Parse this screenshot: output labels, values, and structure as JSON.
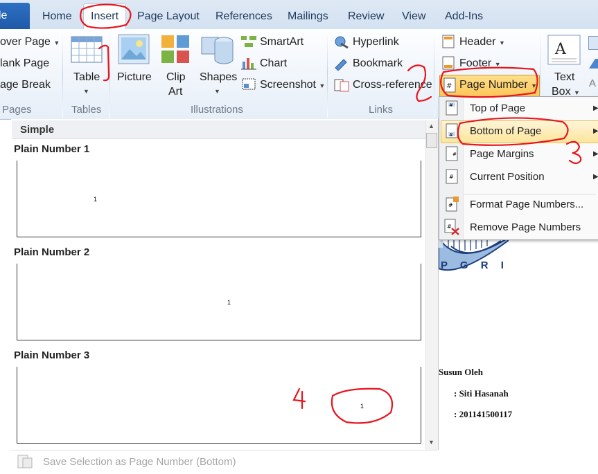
{
  "tabs": {
    "file": "le",
    "items": [
      "Home",
      "Insert",
      "Page Layout",
      "References",
      "Mailings",
      "Review",
      "View",
      "Add-Ins"
    ]
  },
  "ribbon": {
    "pages": {
      "cover_page": "over Page",
      "blank_page": "lank Page",
      "page_break": "age Break",
      "label": "Pages"
    },
    "tables": {
      "table": "Table",
      "label": "Tables"
    },
    "illustrations": {
      "picture": "Picture",
      "clip_art_1": "Clip",
      "clip_art_2": "Art",
      "shapes": "Shapes",
      "smartart": "SmartArt",
      "chart": "Chart",
      "screenshot": "Screenshot",
      "label": "Illustrations"
    },
    "links": {
      "hyperlink": "Hyperlink",
      "bookmark": "Bookmark",
      "cross_reference": "Cross-reference",
      "label": "Links"
    },
    "header_footer": {
      "header": "Header",
      "footer": "Footer",
      "page_number": "Page Number"
    },
    "text": {
      "text_box_1": "Text",
      "text_box_2": "Box",
      "partial": "A"
    }
  },
  "gallery": {
    "section": "Simple",
    "items": [
      {
        "title": "Plain Number 1",
        "number": "1"
      },
      {
        "title": "Plain Number 2",
        "number": "1"
      },
      {
        "title": "Plain Number 3",
        "number": "1"
      }
    ],
    "save_selection": "Save Selection as Page Number (Bottom)"
  },
  "menu": {
    "items": [
      "Top of Page",
      "Bottom of Page",
      "Page Margins",
      "Current Position",
      "Format Page Numbers...",
      "Remove Page Numbers"
    ]
  },
  "document": {
    "logo_text": "P G R I",
    "susun_oleh": "Susun Oleh",
    "name_line": ": Siti Hasanah",
    "id_line": ": 201141500117"
  },
  "annotations": {
    "n1": "1",
    "n2": "2",
    "n3": "3",
    "n4": "4"
  },
  "colors": {
    "annotation": "#e8141c",
    "highlight": "#fde59c",
    "ribbon_text": "#1e395b"
  }
}
